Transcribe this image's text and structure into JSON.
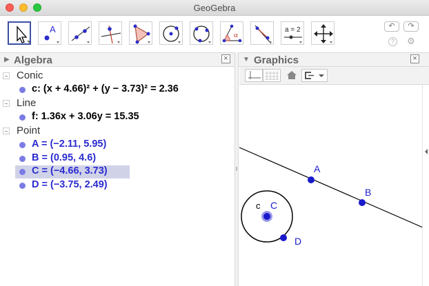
{
  "window": {
    "title": "GeoGebra"
  },
  "toolbar": {
    "tools": [
      {
        "name": "move-tool-icon"
      },
      {
        "name": "point-tool-icon",
        "label": "A"
      },
      {
        "name": "line-tool-icon"
      },
      {
        "name": "perpendicular-line-tool-icon"
      },
      {
        "name": "polygon-tool-icon"
      },
      {
        "name": "circle-center-point-tool-icon"
      },
      {
        "name": "circle-three-points-tool-icon"
      },
      {
        "name": "angle-tool-icon",
        "label": "α"
      },
      {
        "name": "reflect-tool-icon"
      },
      {
        "name": "slider-tool-icon",
        "label": "a = 2"
      },
      {
        "name": "move-graphics-view-tool-icon"
      }
    ],
    "undo_symbol": "↶",
    "redo_symbol": "↷",
    "help_symbol": "?",
    "settings_symbol": "⚙"
  },
  "algebra": {
    "title": "Algebra",
    "close_symbol": "×",
    "categories": [
      {
        "label": "Conic",
        "items": [
          {
            "text": "c: (x + 4.66)² + (y − 3.73)² = 2.36",
            "color": "#000000",
            "dot": "#7b7be5"
          }
        ]
      },
      {
        "label": "Line",
        "items": [
          {
            "text": "f: 1.36x + 3.06y = 15.35",
            "color": "#000000",
            "dot": "#7b7be5"
          }
        ]
      },
      {
        "label": "Point",
        "items": [
          {
            "text": "A = (−2.11, 5.95)",
            "color": "#2b2bd0",
            "dot": "#7b7be5"
          },
          {
            "text": "B = (0.95, 4.6)",
            "color": "#2b2bd0",
            "dot": "#7b7be5"
          },
          {
            "text": "C = (−4.66, 3.73)",
            "color": "#2b2bd0",
            "dot": "#7b7be5",
            "highlighted": true
          },
          {
            "text": "D = (−3.75, 2.49)",
            "color": "#2b2bd0",
            "dot": "#7b7be5"
          }
        ]
      }
    ]
  },
  "graphics": {
    "title": "Graphics",
    "close_symbol": "×",
    "labels": {
      "A": "A",
      "B": "B",
      "C": "C",
      "c": "c",
      "D": "D"
    },
    "colors": {
      "point": "#1a1acc",
      "line": "#000000",
      "selected_halo": "#9a9ae8"
    }
  }
}
